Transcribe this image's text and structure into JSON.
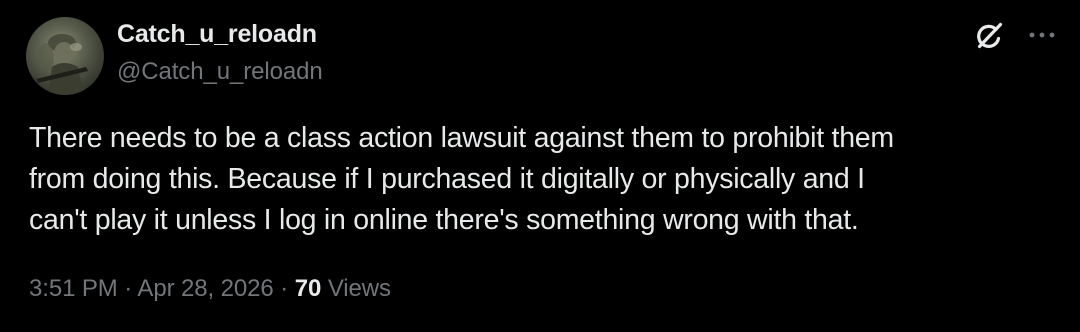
{
  "post": {
    "author": {
      "display_name": "Catch_u_reloadn",
      "handle": "@Catch_u_reloadn"
    },
    "text_lines": [
      "There needs to be a class action lawsuit against them to prohibit them",
      "from doing this. Because if I purchased it digitally or physically and I",
      "can't play it unless I log in online there's something wrong with that."
    ],
    "time": "3:51 PM",
    "separator": "·",
    "date": "Apr 28, 2026",
    "views_count": "70",
    "views_label": "Views"
  },
  "icons": {
    "grok": "grok-icon",
    "more": "more-options-icon"
  },
  "colors": {
    "background": "#000000",
    "primary_text": "#e7e9ea",
    "secondary_text": "#71767b"
  }
}
